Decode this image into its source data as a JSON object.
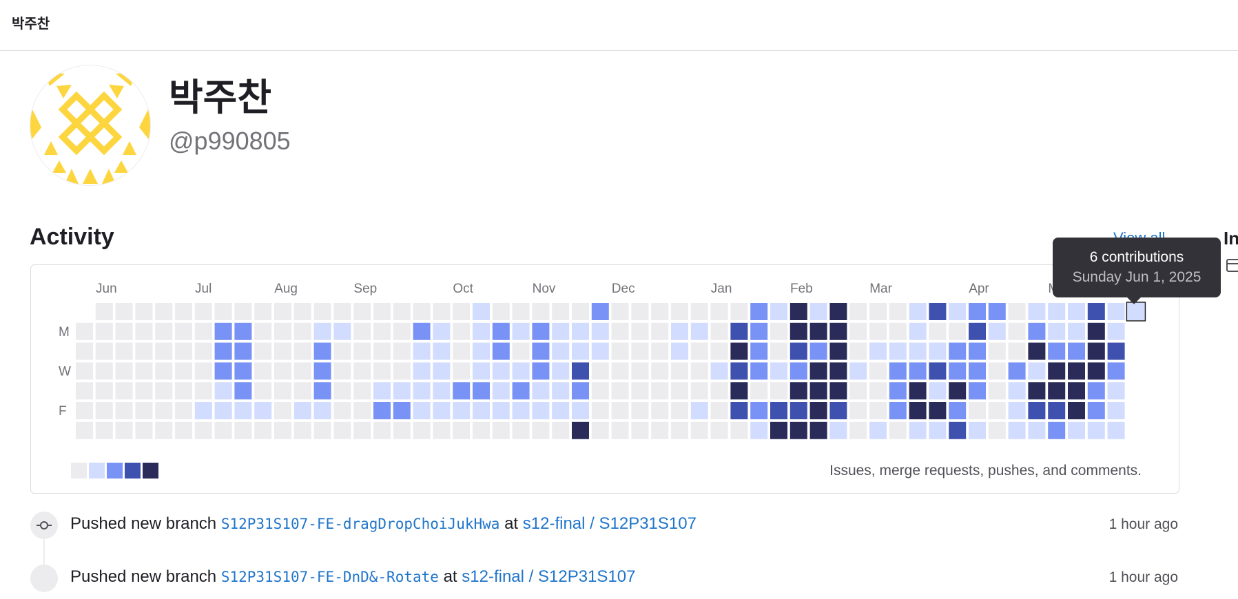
{
  "topbar": {
    "title": "박주찬"
  },
  "profile": {
    "name": "박주찬",
    "username": "@p990805"
  },
  "activity": {
    "heading": "Activity",
    "view_all": "View all",
    "info_heading": "In",
    "months": [
      "Jun",
      "Jul",
      "Aug",
      "Sep",
      "Oct",
      "Nov",
      "Dec",
      "Jan",
      "Feb",
      "Mar",
      "Apr",
      "M"
    ],
    "month_week_index": [
      0,
      5,
      9,
      13,
      18,
      22,
      26,
      31,
      35,
      39,
      44,
      48
    ],
    "day_labels": [
      {
        "row": 1,
        "label": "M"
      },
      {
        "row": 3,
        "label": "W"
      },
      {
        "row": 5,
        "label": "F"
      }
    ],
    "level_colors": [
      "#ececef",
      "#d2dcff",
      "#7992f5",
      "#3f51ae",
      "#2a2b59"
    ],
    "weeks": [
      [
        null,
        0,
        0,
        0,
        0,
        0,
        0
      ],
      [
        0,
        0,
        0,
        0,
        0,
        0,
        0
      ],
      [
        0,
        0,
        0,
        0,
        0,
        0,
        0
      ],
      [
        0,
        0,
        0,
        0,
        0,
        0,
        0
      ],
      [
        0,
        0,
        0,
        0,
        0,
        0,
        0
      ],
      [
        0,
        0,
        0,
        0,
        0,
        0,
        0
      ],
      [
        0,
        0,
        0,
        0,
        0,
        1,
        0
      ],
      [
        0,
        2,
        2,
        2,
        1,
        1,
        0
      ],
      [
        0,
        2,
        2,
        2,
        2,
        1,
        0
      ],
      [
        0,
        0,
        0,
        0,
        0,
        1,
        0
      ],
      [
        0,
        0,
        0,
        0,
        0,
        0,
        0
      ],
      [
        0,
        0,
        0,
        0,
        0,
        1,
        0
      ],
      [
        0,
        1,
        2,
        2,
        2,
        1,
        0
      ],
      [
        0,
        1,
        0,
        0,
        0,
        0,
        0
      ],
      [
        0,
        0,
        0,
        0,
        0,
        0,
        0
      ],
      [
        0,
        0,
        0,
        0,
        1,
        2,
        0
      ],
      [
        0,
        0,
        0,
        0,
        1,
        2,
        0
      ],
      [
        0,
        2,
        1,
        1,
        1,
        1,
        0
      ],
      [
        0,
        1,
        1,
        1,
        1,
        1,
        0
      ],
      [
        0,
        0,
        0,
        0,
        2,
        1,
        0
      ],
      [
        1,
        1,
        1,
        1,
        2,
        1,
        0
      ],
      [
        0,
        2,
        2,
        1,
        1,
        1,
        0
      ],
      [
        0,
        1,
        0,
        1,
        2,
        1,
        0
      ],
      [
        0,
        2,
        2,
        2,
        1,
        1,
        0
      ],
      [
        0,
        1,
        1,
        1,
        1,
        1,
        0
      ],
      [
        0,
        1,
        1,
        3,
        2,
        1,
        4
      ],
      [
        2,
        1,
        1,
        0,
        0,
        0,
        0
      ],
      [
        0,
        0,
        0,
        0,
        0,
        0,
        0
      ],
      [
        0,
        0,
        0,
        0,
        0,
        0,
        0
      ],
      [
        0,
        0,
        0,
        0,
        0,
        0,
        0
      ],
      [
        0,
        1,
        1,
        0,
        0,
        0,
        0
      ],
      [
        0,
        1,
        0,
        0,
        0,
        1,
        0
      ],
      [
        0,
        0,
        0,
        1,
        0,
        0,
        0
      ],
      [
        0,
        3,
        4,
        3,
        4,
        3,
        0
      ],
      [
        2,
        2,
        2,
        2,
        0,
        2,
        1
      ],
      [
        1,
        0,
        0,
        1,
        0,
        3,
        4
      ],
      [
        4,
        4,
        3,
        2,
        4,
        3,
        4
      ],
      [
        1,
        4,
        2,
        4,
        4,
        4,
        4
      ],
      [
        4,
        4,
        4,
        4,
        4,
        3,
        1
      ],
      [
        0,
        0,
        0,
        1,
        0,
        0,
        0
      ],
      [
        0,
        0,
        1,
        0,
        0,
        0,
        1
      ],
      [
        0,
        0,
        1,
        2,
        2,
        2,
        0
      ],
      [
        1,
        1,
        1,
        2,
        4,
        4,
        1
      ],
      [
        3,
        0,
        1,
        3,
        1,
        4,
        1
      ],
      [
        1,
        0,
        2,
        2,
        4,
        2,
        3
      ],
      [
        2,
        3,
        2,
        2,
        2,
        0,
        1
      ],
      [
        2,
        1,
        0,
        0,
        0,
        0,
        0
      ],
      [
        0,
        0,
        0,
        2,
        1,
        1,
        1
      ],
      [
        1,
        2,
        4,
        1,
        4,
        3,
        1
      ],
      [
        1,
        1,
        2,
        4,
        4,
        3,
        2
      ],
      [
        1,
        1,
        2,
        4,
        4,
        4,
        1
      ],
      [
        3,
        4,
        4,
        4,
        2,
        2,
        1
      ],
      [
        1,
        1,
        3,
        2,
        1,
        1,
        1
      ],
      [
        1,
        null,
        null,
        null,
        null,
        null,
        null
      ]
    ],
    "caption": "Issues, merge requests, pushes, and comments.",
    "tooltip": {
      "title": "6 contributions",
      "date": "Sunday Jun 1, 2025"
    }
  },
  "events": [
    {
      "action": "Pushed new branch",
      "branch": "S12P31S107-FE-dragDropChoiJukHwa",
      "at": "at",
      "project": "s12-final / S12P31S107",
      "time": "1 hour ago"
    },
    {
      "action": "Pushed new branch",
      "branch": "S12P31S107-FE-DnD&-Rotate",
      "at": "at",
      "project": "s12-final / S12P31S107",
      "time": "1 hour ago"
    }
  ]
}
